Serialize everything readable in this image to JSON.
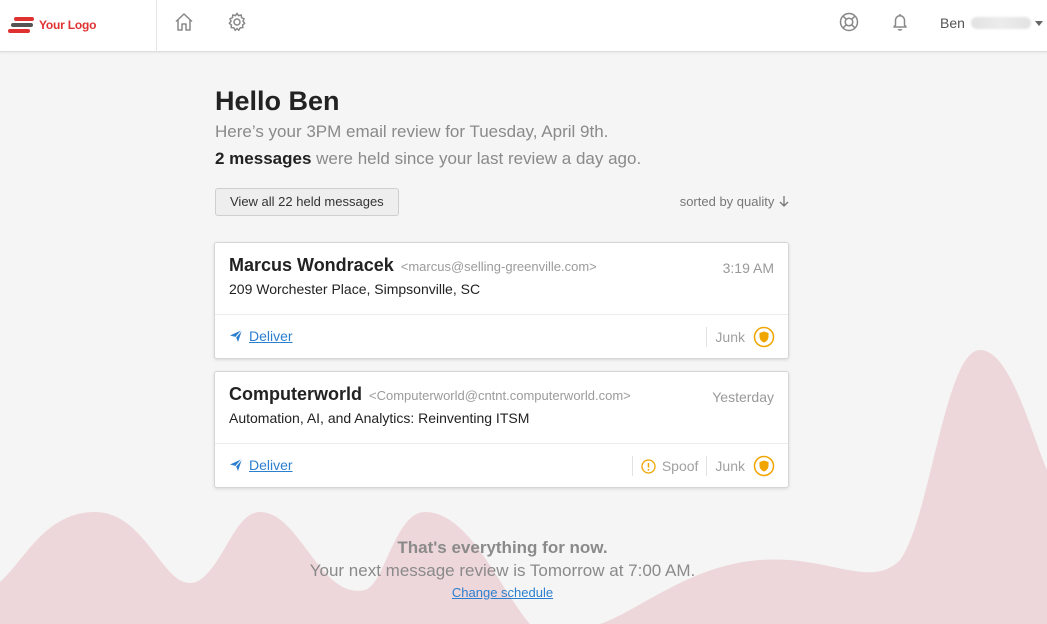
{
  "header": {
    "logo_text": "Your Logo",
    "logo_colors": [
      "#e03131",
      "#555555",
      "#e03131"
    ],
    "icons": [
      "home-icon",
      "gear-icon",
      "help-lifebuoy-icon",
      "bell-icon"
    ],
    "user_name": "Ben"
  },
  "main": {
    "greeting": "Hello Ben",
    "subline": "Here’s your 3PM email review for Tuesday, April 9th.",
    "held_count": "2 messages",
    "held_suffix": " were held since your last review a day ago.",
    "view_all_label": "View all 22 held messages",
    "sort_label": "sorted by quality",
    "sort_icon": "arrow-down-icon"
  },
  "messages": [
    {
      "sender": "Marcus Wondracek",
      "email": "<marcus@selling-greenville.com>",
      "time": "3:19 AM",
      "subject": "209 Worchester Place, Simpsonville, SC",
      "deliver_label": "Deliver",
      "tags": [
        "Junk"
      ]
    },
    {
      "sender": "Computerworld",
      "email": "<Computerworld@cntnt.computerworld.com>",
      "time": "Yesterday",
      "subject": "Automation, AI, and Analytics: Reinventing ITSM",
      "deliver_label": "Deliver",
      "tags": [
        "Spoof",
        "Junk"
      ]
    }
  ],
  "footer": {
    "title": "That's everything for now.",
    "next_review": "Your next message review is Tomorrow at 7:00 AM.",
    "change_link": "Change schedule"
  },
  "colors": {
    "accent_link": "#2c7fcf",
    "brand_red": "#e03131",
    "warning_orange": "#f0a500",
    "wave_pink": "#efd8da",
    "background": "#f5f5f5"
  }
}
